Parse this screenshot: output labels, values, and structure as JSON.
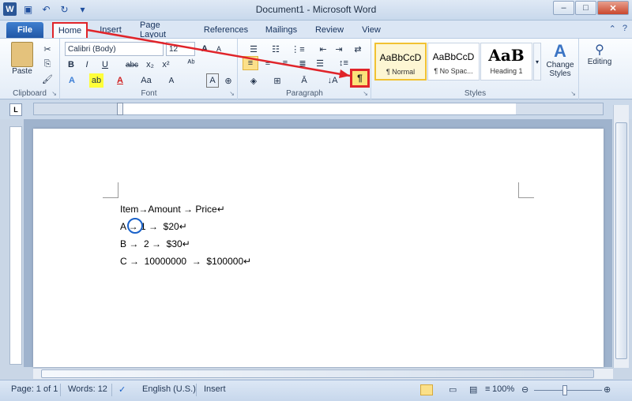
{
  "window": {
    "title": "Document1 - Microsoft Word",
    "min": "–",
    "max": "□",
    "close": "✕"
  },
  "qat": {
    "word_icon": "W",
    "save_icon": "💾",
    "undo_icon": "↶",
    "redo_icon": "↻",
    "customize_icon": "▾"
  },
  "tabs": {
    "file": "File",
    "home": "Home",
    "insert": "Insert",
    "page_layout": "Page Layout",
    "references": "References",
    "mailings": "Mailings",
    "review": "Review",
    "view": "View"
  },
  "clipboard": {
    "label": "Clipboard",
    "paste": "Paste"
  },
  "font": {
    "label": "Font",
    "name": "Calibri (Body)",
    "size": "12",
    "bold": "B",
    "italic": "I",
    "underline": "U",
    "strike": "abc",
    "sub": "x₂",
    "sup": "x²",
    "grow": "A",
    "shrink": "A",
    "case": "Aa",
    "clear": "A"
  },
  "paragraph": {
    "label": "Paragraph",
    "show_marks": "¶"
  },
  "styles": {
    "label": "Styles",
    "items": [
      {
        "sample": "AaBbCcD",
        "name": "¶ Normal"
      },
      {
        "sample": "AaBbCcD",
        "name": "¶ No Spac..."
      },
      {
        "sample": "AaB",
        "name": "Heading 1"
      }
    ],
    "change_styles": "Change Styles"
  },
  "editing": {
    "label": "Editing"
  },
  "document": {
    "lines": [
      "Item→Amount → Price↵",
      "A → 1 →  $20↵",
      "B →  2 →  $30↵",
      "C →  10000000  →  $100000↵"
    ]
  },
  "status": {
    "page": "Page: 1 of 1",
    "words": "Words: 12",
    "language": "English (U.S.)",
    "mode": "Insert",
    "zoom": "100%"
  },
  "colors": {
    "annotation_red": "#e0242a",
    "annotation_blue": "#1a62c9",
    "file_tab": "#2b62b5"
  }
}
